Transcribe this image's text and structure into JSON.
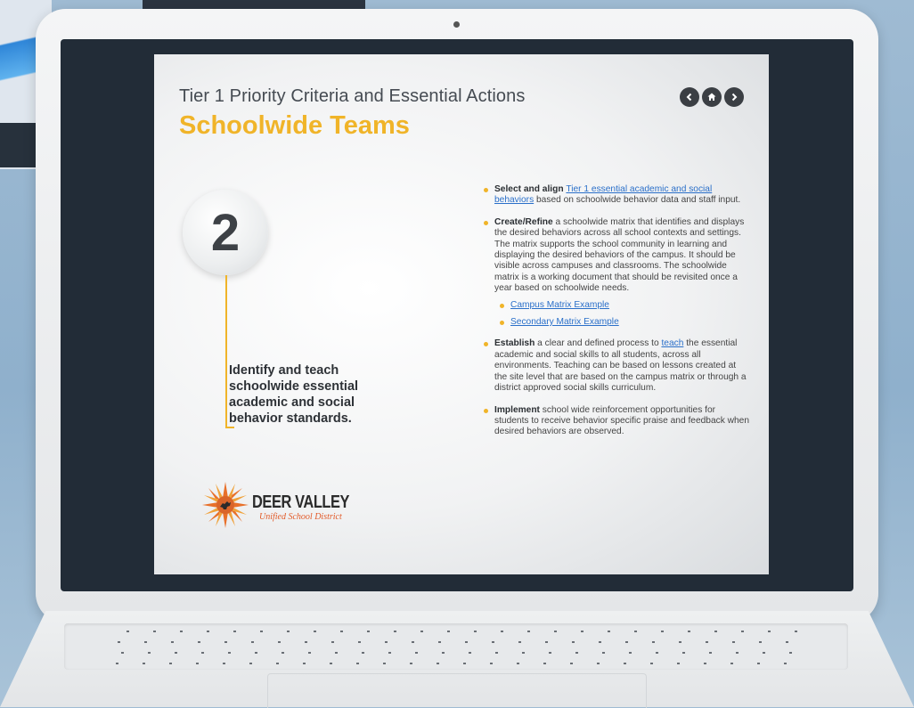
{
  "slide": {
    "subtitle": "Tier 1 Priority Criteria and Essential Actions",
    "title": "Schoolwide Teams",
    "step_number": "2",
    "objective": "Identify and teach schoolwide essential academic and social behavior standards.",
    "logo": {
      "name": "DEER VALLEY",
      "subtitle": "Unified School District"
    },
    "nav": {
      "prev_icon": "chevron-left-icon",
      "home_icon": "home-icon",
      "next_icon": "chevron-right-icon"
    },
    "bullets": [
      {
        "lead": "Select and align",
        "link": "Tier 1 essential academic and social behaviors",
        "rest": " based on schoolwide behavior data and staff input."
      },
      {
        "lead": "Create/Refine",
        "text": " a schoolwide matrix that identifies and displays the desired behaviors across all school contexts and settings. The matrix supports the school community in learning and displaying the desired behaviors of the campus. It should be visible across campuses and classrooms. The schoolwide matrix is a working document that should be revisited once a year based on schoolwide needs.",
        "sub_links": [
          "Campus Matrix Example",
          "Secondary Matrix Example"
        ]
      },
      {
        "lead": "Establish",
        "pre": " a clear and defined process to ",
        "link": "teach",
        "rest": " the essential academic and social skills to all students, across all environments. Teaching can be based on lessons created at the site level that are based on the campus matrix or through a district approved social skills curriculum."
      },
      {
        "lead": "Implement",
        "text": " school wide reinforcement opportunities for students to receive behavior specific praise and feedback when desired behaviors are observed."
      }
    ]
  },
  "colors": {
    "accent": "#f0b429",
    "link": "#2a6fc9",
    "bezel": "#222c37"
  }
}
